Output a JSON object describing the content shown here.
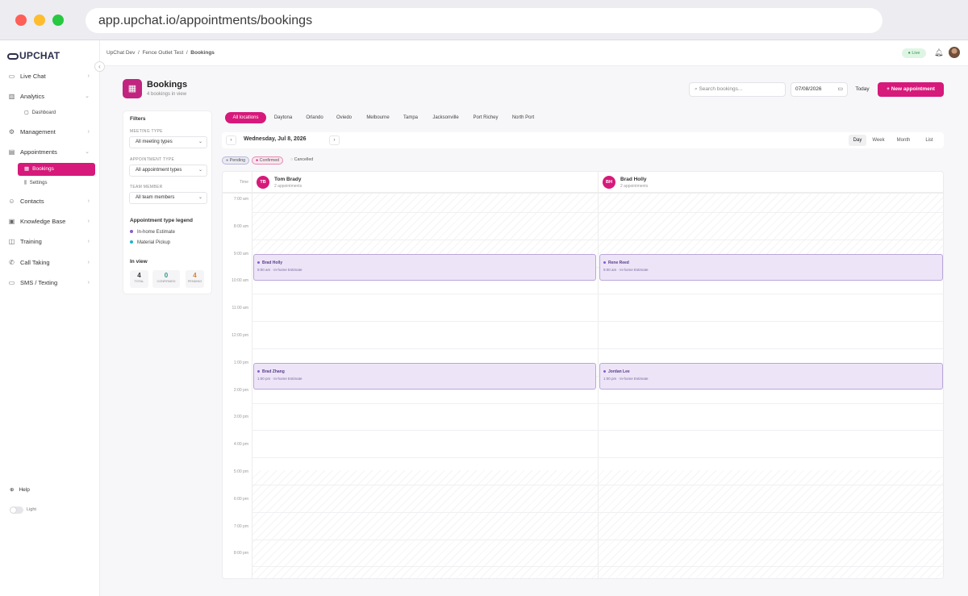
{
  "browser": {
    "url": "app.upchat.io/appointments/bookings"
  },
  "logo": "UPCHAT",
  "sidebar": {
    "items": [
      {
        "label": "Live Chat",
        "icon": "chat-icon"
      },
      {
        "label": "Analytics",
        "icon": "analytics-icon"
      },
      {
        "label": "Dashboard",
        "icon": "dashboard-icon"
      },
      {
        "label": "Management",
        "icon": "gear-icon"
      },
      {
        "label": "Appointments",
        "icon": "calendar-icon"
      },
      {
        "label": "Bookings",
        "icon": "bookings-icon"
      },
      {
        "label": "Settings",
        "icon": "settings-icon"
      },
      {
        "label": "Contacts",
        "icon": "contacts-icon"
      },
      {
        "label": "Knowledge Base",
        "icon": "book-icon"
      },
      {
        "label": "Training",
        "icon": "training-icon"
      },
      {
        "label": "Call Taking",
        "icon": "phone-icon"
      },
      {
        "label": "SMS / Texting",
        "icon": "sms-icon"
      }
    ],
    "help": "Help",
    "theme": "Light"
  },
  "topbar": {
    "breadcrumb": [
      "UpChat Dev",
      "Fence Outlet Test",
      "Bookings"
    ],
    "live": "Live"
  },
  "page": {
    "title": "Bookings",
    "subtitle": "4 bookings in view"
  },
  "search": {
    "placeholder": "Search bookings..."
  },
  "date_input": "07/08/2026",
  "today_label": "Today",
  "new_appointment": "+ New appointment",
  "filters": {
    "title": "Filters",
    "meeting_type_label": "MEETING TYPE",
    "meeting_type_value": "All meeting types",
    "appointment_type_label": "APPOINTMENT TYPE",
    "appointment_type_value": "All appointment types",
    "team_member_label": "TEAM MEMBER",
    "team_member_value": "All team members",
    "legend_title": "Appointment type legend",
    "legend": [
      {
        "label": "In-home Estimate",
        "color": "#8a5bd0"
      },
      {
        "label": "Material Pickup",
        "color": "#1fb5c9"
      }
    ],
    "inview_title": "In view",
    "stats": [
      {
        "value": "4",
        "label": "TOTAL",
        "color": "#333"
      },
      {
        "value": "0",
        "label": "CONFIRMED",
        "color": "#2e9a8a"
      },
      {
        "value": "4",
        "label": "PENDING",
        "color": "#d9822b"
      }
    ]
  },
  "locations": [
    "All locations",
    "Daytona",
    "Orlando",
    "Oviedo",
    "Melbourne",
    "Tampa",
    "Jacksonville",
    "Port Richey",
    "North Port"
  ],
  "datebar": {
    "date": "Wednesday, Jul 8, 2026",
    "views": [
      "Day",
      "Week",
      "Month",
      "List"
    ],
    "active_view": "Day"
  },
  "statuses": [
    "Pending",
    "Confirmed",
    "Cancelled"
  ],
  "calendar": {
    "time_header": "Time",
    "times": [
      "7:00 am",
      "8:00 am",
      "9:00 am",
      "10:00 am",
      "11:00 am",
      "12:00 pm",
      "1:00 pm",
      "2:00 pm",
      "3:00 pm",
      "4:00 pm",
      "5:00 pm",
      "6:00 pm",
      "7:00 pm",
      "8:00 pm"
    ],
    "staff": [
      {
        "initials": "TB",
        "name": "Tom Brady",
        "sub": "2 appointments"
      },
      {
        "initials": "BH",
        "name": "Brad Holly",
        "sub": "2 appointments"
      }
    ],
    "appointments": [
      {
        "name": "Brad Holly",
        "detail": "9:00 am · In-home Estimate"
      },
      {
        "name": "Rene Reed",
        "detail": "9:00 am · In-home Estimate"
      },
      {
        "name": "Brad Zhang",
        "detail": "1:00 pm · In-home Estimate"
      },
      {
        "name": "Jordan Lee",
        "detail": "1:00 pm · In-home Estimate"
      }
    ]
  }
}
